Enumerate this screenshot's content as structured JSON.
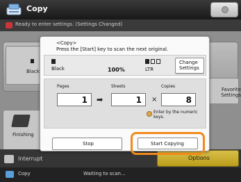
{
  "app": {
    "title": "Copy"
  },
  "status": {
    "message": "Ready to enter settings. (Settings Changed)"
  },
  "background": {
    "black_button": "Black",
    "favorite_label": "Favorite Settings",
    "finishing_label": "Finishing",
    "interrupt_label": "Interrupt",
    "options_label": "Options"
  },
  "footer": {
    "label": "Copy",
    "status": "Waiting to scan..."
  },
  "dialog": {
    "msg1": "<Copy>",
    "msg2": "Press the [Start] key to scan the next original.",
    "color_mode": "Black",
    "zoom": "100%",
    "paper": "LTR",
    "change_settings": "Change Settings",
    "pages_label": "Pages",
    "pages_value": "1",
    "sheets_label": "Sheets",
    "sheets_value": "1",
    "copies_label": "Copies",
    "copies_value": "8",
    "hint": "Enter by the numeric keys.",
    "stop_label": "Stop",
    "start_label": "Start Copying"
  },
  "colors": {
    "accent_orange": "#f08a1a",
    "options_yellow": "#e7c53a"
  }
}
